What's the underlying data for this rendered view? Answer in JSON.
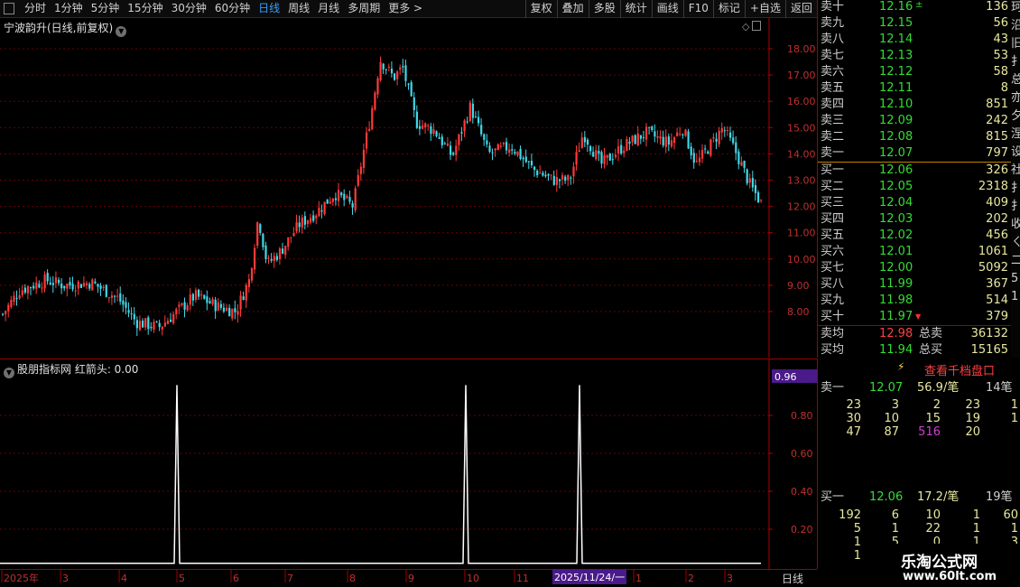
{
  "toolbar": {
    "periods": [
      "分时",
      "1分钟",
      "5分钟",
      "15分钟",
      "30分钟",
      "60分钟",
      "日线",
      "周线",
      "月线",
      "多周期",
      "更多 >"
    ],
    "active_period": "日线",
    "actions": [
      "复权",
      "叠加",
      "多股",
      "统计",
      "画线",
      "F10",
      "标记",
      "+自选",
      "返回"
    ]
  },
  "main_chart": {
    "title": "宁波韵升(日线,前复权)",
    "price_ticks": [
      "18.00",
      "17.00",
      "16.00",
      "15.00",
      "14.00",
      "13.00",
      "12.00",
      "11.00",
      "10.00",
      "9.00",
      "8.00"
    ],
    "up_color": "#ff3a3a",
    "down_color": "#40d8e8"
  },
  "indicator": {
    "title": "股朋指标网 红箭头: 0.00",
    "value_tag": "0.96",
    "ticks": [
      "0.80",
      "0.60",
      "0.40",
      "0.20"
    ],
    "spike_color": "#ffffff"
  },
  "date_axis": {
    "labels": [
      "2025年",
      "3",
      "4",
      "5",
      "6",
      "7",
      "8",
      "9",
      "10",
      "11",
      "1",
      "2",
      "3"
    ],
    "cursor_date": "2025/11/24/一",
    "period_label": "日线"
  },
  "orderbook": {
    "asks": [
      {
        "label": "卖十",
        "price": "12.16",
        "vol": "136"
      },
      {
        "label": "卖九",
        "price": "12.15",
        "vol": "56"
      },
      {
        "label": "卖八",
        "price": "12.14",
        "vol": "43"
      },
      {
        "label": "卖七",
        "price": "12.13",
        "vol": "53"
      },
      {
        "label": "卖六",
        "price": "12.12",
        "vol": "58"
      },
      {
        "label": "卖五",
        "price": "12.11",
        "vol": "8"
      },
      {
        "label": "卖四",
        "price": "12.10",
        "vol": "851"
      },
      {
        "label": "卖三",
        "price": "12.09",
        "vol": "242"
      },
      {
        "label": "卖二",
        "price": "12.08",
        "vol": "815"
      },
      {
        "label": "卖一",
        "price": "12.07",
        "vol": "797"
      }
    ],
    "bids": [
      {
        "label": "买一",
        "price": "12.06",
        "vol": "326"
      },
      {
        "label": "买二",
        "price": "12.05",
        "vol": "2318"
      },
      {
        "label": "买三",
        "price": "12.04",
        "vol": "409"
      },
      {
        "label": "买四",
        "price": "12.03",
        "vol": "202"
      },
      {
        "label": "买五",
        "price": "12.02",
        "vol": "456"
      },
      {
        "label": "买六",
        "price": "12.01",
        "vol": "1061"
      },
      {
        "label": "买七",
        "price": "12.00",
        "vol": "5092"
      },
      {
        "label": "买八",
        "price": "11.99",
        "vol": "367"
      },
      {
        "label": "买九",
        "price": "11.98",
        "vol": "514"
      },
      {
        "label": "买十",
        "price": "11.97",
        "vol": "379"
      }
    ],
    "ask_avg_label": "卖均",
    "ask_avg": "12.98",
    "ask_total_label": "总卖",
    "ask_total": "36132",
    "bid_avg_label": "买均",
    "bid_avg": "11.94",
    "bid_total_label": "总买",
    "bid_total": "15165",
    "right_edge_chars": [
      "珂",
      "沿",
      "旧",
      "扌",
      "总",
      "亦",
      "夕",
      "涅",
      "设",
      "社",
      "扌",
      "扌",
      "收",
      "ㄑ",
      "二",
      "5",
      "1"
    ]
  },
  "ticks": {
    "qiandang_label": "查看千档盘口",
    "sell_label": "卖一",
    "sell_price": "12.07",
    "sell_avg": "56.9/笔",
    "sell_count": "14笔",
    "sell_rows": [
      [
        "23",
        "3",
        "2",
        "23",
        "1"
      ],
      [
        "30",
        "10",
        "15",
        "19",
        "1"
      ],
      [
        "47",
        "87",
        "516",
        "20",
        ""
      ]
    ],
    "buy_label": "买一",
    "buy_price": "12.06",
    "buy_avg": "17.2/笔",
    "buy_count": "19笔",
    "buy_rows": [
      [
        "192",
        "6",
        "10",
        "1",
        "60"
      ],
      [
        "5",
        "1",
        "22",
        "1",
        "1"
      ],
      [
        "1",
        "5",
        "0",
        "1",
        "3"
      ],
      [
        "1",
        "",
        "",
        "",
        ""
      ]
    ],
    "highlight_color": "#d040d0"
  },
  "watermark": {
    "line1": "乐淘公式网",
    "line2": "www.60lt.com"
  }
}
